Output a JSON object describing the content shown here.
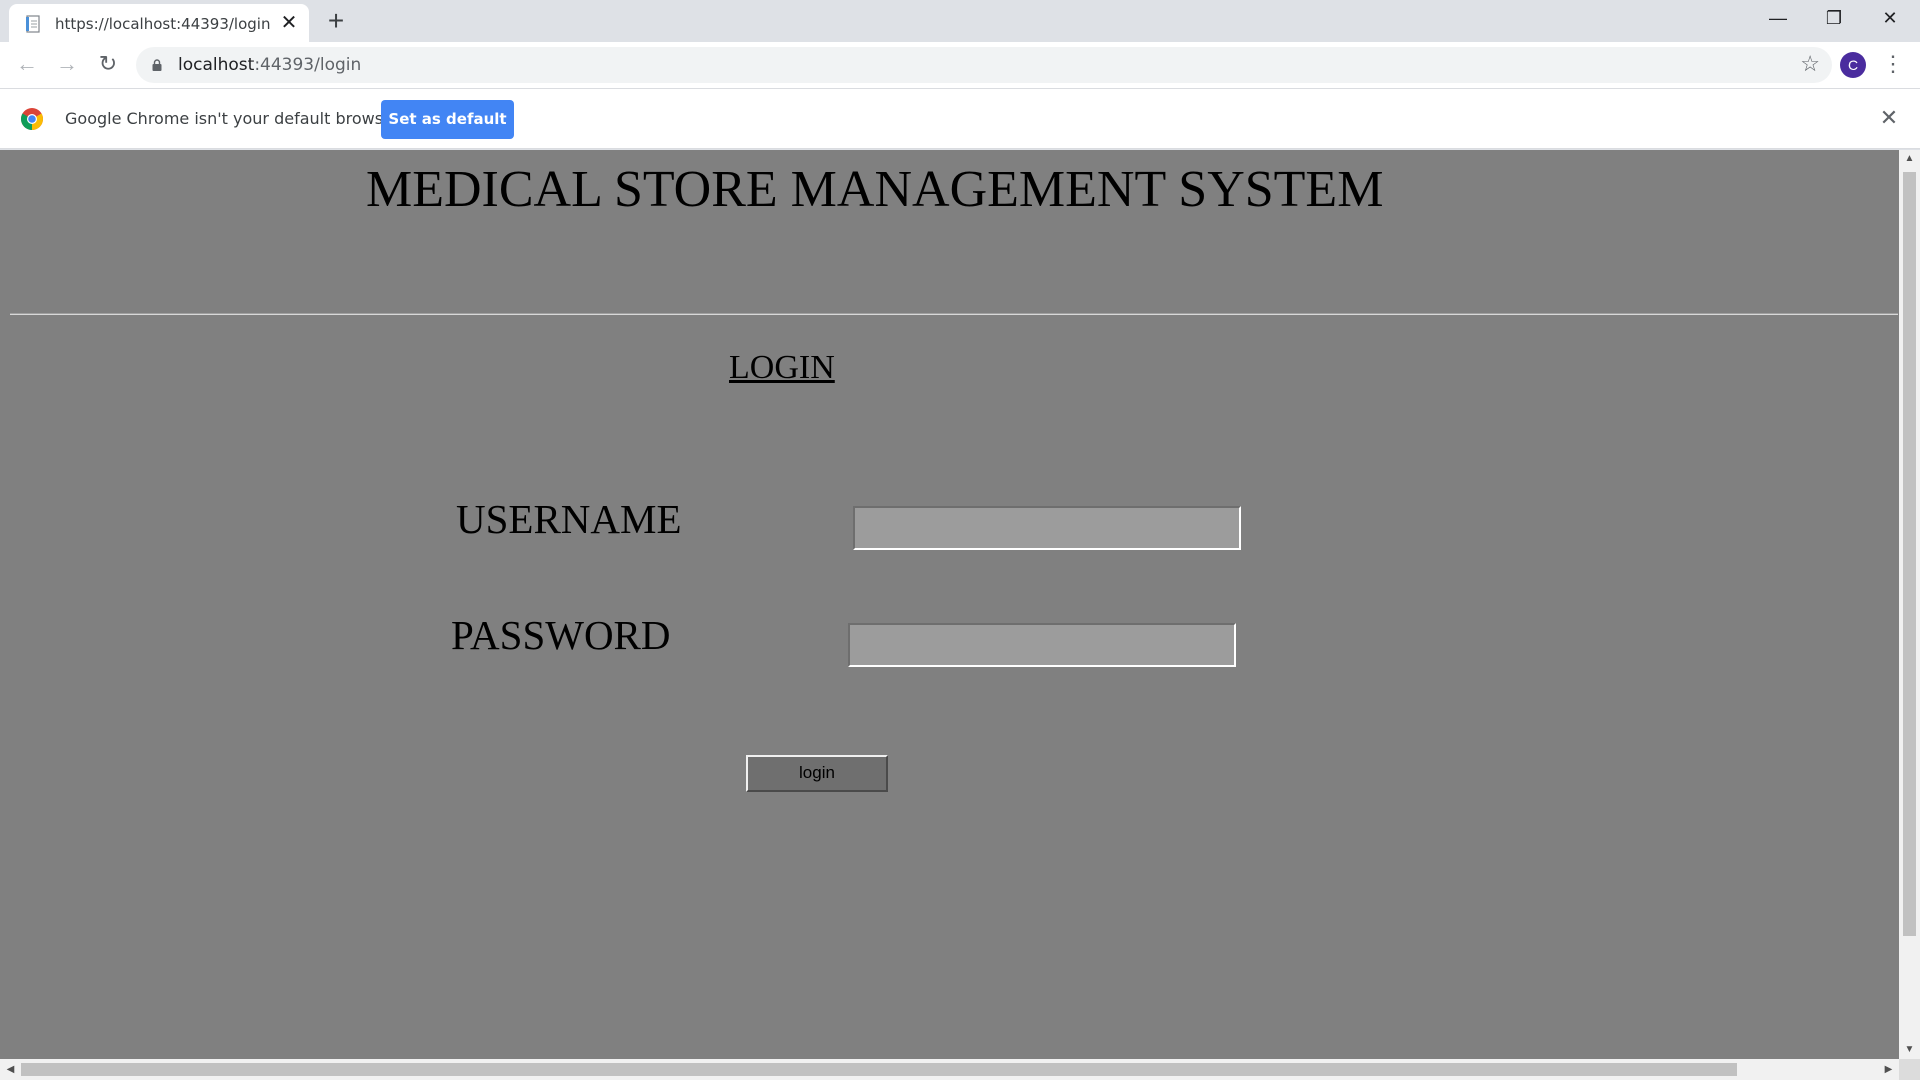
{
  "browser": {
    "tab": {
      "title": "https://localhost:44393/login",
      "favicon": "page-icon",
      "close_glyph": "✕"
    },
    "new_tab_glyph": "+",
    "window_controls": {
      "minimize_glyph": "—",
      "maximize_glyph": "❐",
      "close_glyph": "✕"
    },
    "nav": {
      "back_glyph": "←",
      "forward_glyph": "→",
      "reload_glyph": "↻"
    },
    "address": {
      "host": "localhost",
      "rest": ":44393/login"
    },
    "bookmark_glyph": "☆",
    "profile_initial": "C",
    "menu_glyph": "⋮",
    "infobar": {
      "message": "Google Chrome isn't your default browser",
      "button_label": "Set as default",
      "close_glyph": "✕"
    }
  },
  "page": {
    "title": "MEDICAL STORE MANAGEMENT SYSTEM",
    "heading": "LOGIN",
    "username_label": "USERNAME",
    "username_value": "",
    "password_label": "PASSWORD",
    "password_value": "",
    "login_button": "login",
    "background_color": "#808080"
  },
  "scrollbars": {
    "up_glyph": "▲",
    "down_glyph": "▼",
    "left_glyph": "◀",
    "right_glyph": "▶"
  },
  "colors": {
    "accent": "#4285f4",
    "profile": "#4a2c9e"
  }
}
